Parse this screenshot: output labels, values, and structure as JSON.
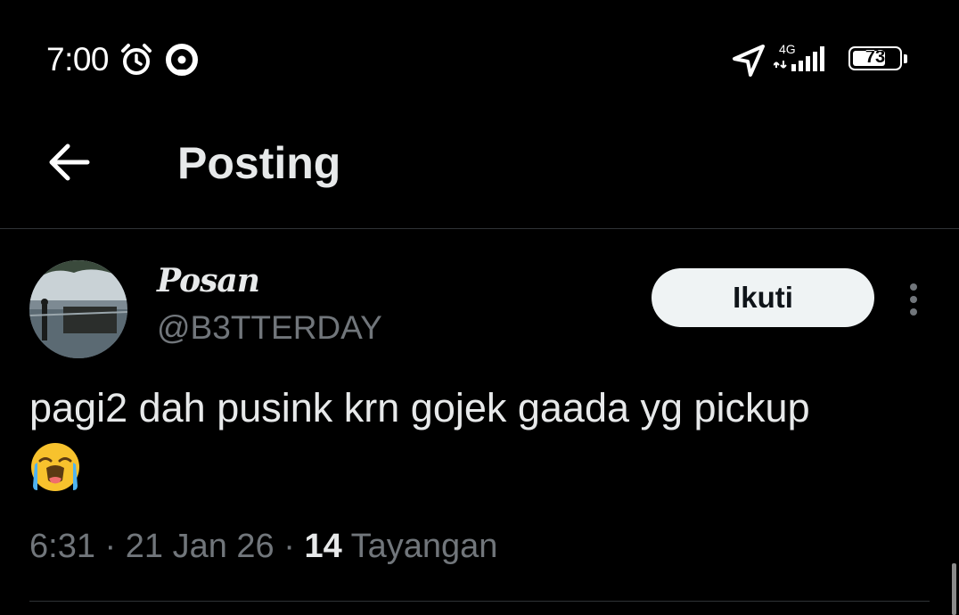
{
  "status_bar": {
    "time": "7:00",
    "network_type": "4G",
    "battery_level": "73",
    "battery_fraction": 0.73,
    "icons": [
      "alarm-icon",
      "gojek-icon",
      "location-arrow-icon",
      "signal-icon",
      "battery-icon"
    ]
  },
  "header": {
    "title": "Posting",
    "back_icon": "arrow-left-icon"
  },
  "post": {
    "display_name": "Posan",
    "handle": "@B3TTERDAY",
    "follow_label": "Ikuti",
    "more_icon": "more-vertical-icon",
    "text": "pagi2 dah pusink krn gojek gaada yg pickup",
    "emoji": "loudly-crying-face",
    "time": "6:31",
    "separator": "·",
    "date": "21 Jan 26",
    "views_count": "14",
    "views_label": "Tayangan"
  },
  "colors": {
    "background": "#000000",
    "text_primary": "#e7e9ea",
    "text_secondary": "#71767b",
    "button_bg": "#eff3f4",
    "divider": "#2f3336"
  }
}
